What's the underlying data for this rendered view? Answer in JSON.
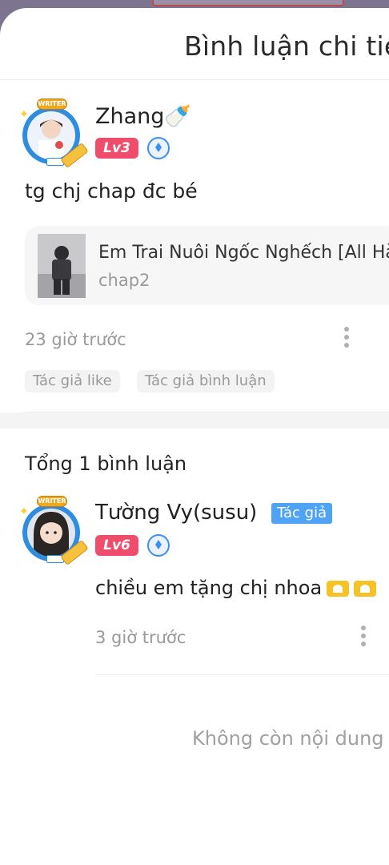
{
  "sheet": {
    "title": "Bình luận chi tiết"
  },
  "comment": {
    "user": {
      "name": "Zhang🍼",
      "level": "Lv3",
      "avatar_badge": "WRITER"
    },
    "text": "tg chj chap đc bé",
    "book": {
      "title": "Em Trai Nuôi Ngốc Nghếch [All Hà",
      "chapter": "chap2"
    },
    "time": "23 giờ trước",
    "tags": [
      "Tác giả like",
      "Tác giả bình luận"
    ]
  },
  "replies": {
    "total_label": "Tổng 1 bình luận",
    "items": [
      {
        "name": "Tường Vy(susu)",
        "author_tag": "Tác giả",
        "level": "Lv6",
        "avatar_badge": "WRITER",
        "text": "chiều em tặng chị nhoa",
        "time": "3 giờ trước"
      }
    ]
  },
  "footer": {
    "end_text": "Không còn nội dung"
  },
  "colors": {
    "level_badge": "#f04c6c",
    "author_tag": "#4fa3f5",
    "vip_icon": "#3b8ff2"
  },
  "icons": [
    "vip-diamond-icon",
    "more-options-icon",
    "heart-hands-emoji"
  ]
}
